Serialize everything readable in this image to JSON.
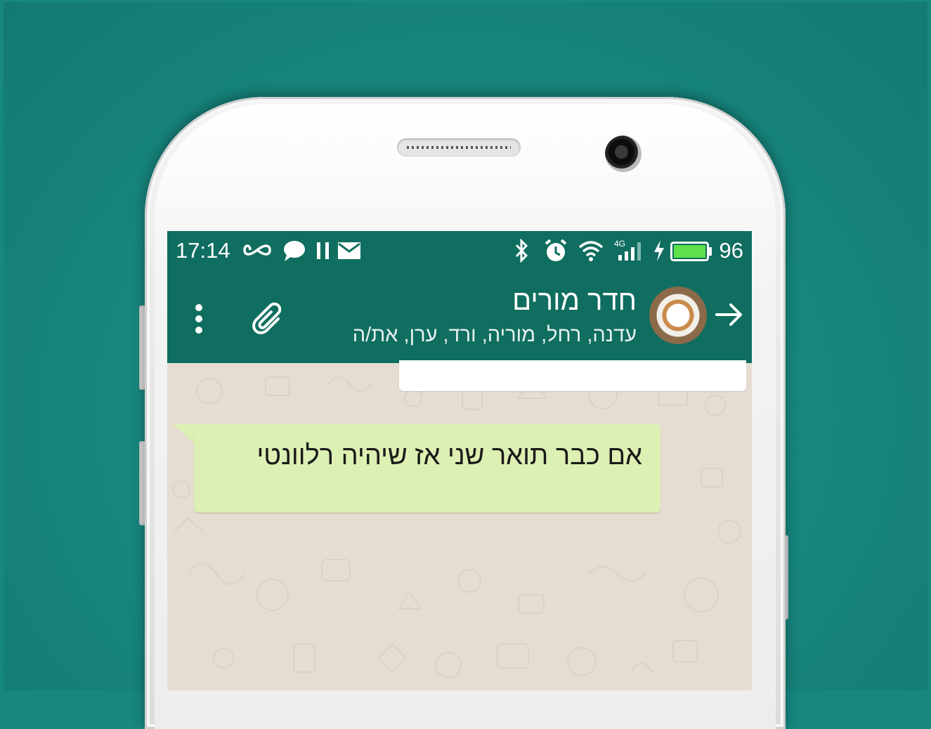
{
  "status_bar": {
    "time": "17:14",
    "battery_percent": "96",
    "signal_label": "4G",
    "icons": [
      "infinity-icon",
      "chat-bubble-icon",
      "pause-icon",
      "mail-icon",
      "bluetooth-icon",
      "alarm-icon",
      "wifi-icon",
      "signal-icon",
      "charging-icon",
      "battery-icon"
    ]
  },
  "chat_header": {
    "group_name": "חדר מורים",
    "participants": "עדנה, רחל, מוריה, ורד, ערן, את/ה",
    "icons": [
      "back-arrow-icon",
      "group-avatar",
      "attach-icon",
      "more-options-icon"
    ]
  },
  "messages": [
    {
      "text": "אם כבר תואר שני אז שיהיה רלוונטי",
      "type": "outgoing"
    }
  ],
  "colors": {
    "background": "#17877f",
    "header": "#0f6e5f",
    "chat_background": "#e6ddd2",
    "bubble": "#dcf0b3"
  }
}
